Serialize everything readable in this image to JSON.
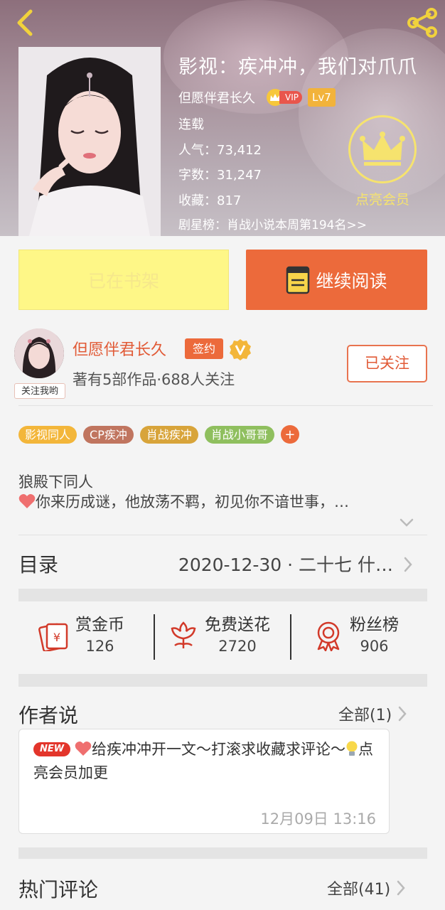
{
  "header": {
    "book_title": "影视：疾冲冲，我们对爪爪",
    "author_name": "但愿伴君长久",
    "vip_label": "VIP",
    "level": "Lv7",
    "status": "连载",
    "popularity": "人气：73,412",
    "word_count": "字数：31,247",
    "favorites": "收藏：817",
    "rank": "剧星榜：肖战小说本周第194名>>",
    "vip_cta": "点亮会员"
  },
  "actions": {
    "shelf_label": "已在书架",
    "read_label": "继续阅读"
  },
  "author": {
    "name": "但愿伴君长久",
    "sign_tag": "签约",
    "follow_me": "关注我哟",
    "stats": "著有5部作品·688人关注",
    "follow_button": "已关注"
  },
  "tags": [
    {
      "label": "影视同人",
      "color": "#f3b63a"
    },
    {
      "label": "CP疾冲",
      "color": "#c0755f"
    },
    {
      "label": "肖战疾冲",
      "color": "#d8a43a"
    },
    {
      "label": "肖战小哥哥",
      "color": "#8fbf5e"
    }
  ],
  "tag_add": "+",
  "synopsis": {
    "line1": "狼殿下同人",
    "line2": "你来历成谜，他放荡不羁，初见你不谙世事，…"
  },
  "catalog": {
    "title": "目录",
    "latest": "2020-12-30 · 二十七 什…"
  },
  "gifts": [
    {
      "label": "赏金币",
      "count": "126",
      "icon": "red-envelope-icon"
    },
    {
      "label": "免费送花",
      "count": "2720",
      "icon": "flower-icon"
    },
    {
      "label": "粉丝榜",
      "count": "906",
      "icon": "medal-icon"
    }
  ],
  "author_says": {
    "title": "作者说",
    "more": "全部(1)",
    "badge": "NEW",
    "text_part1": "给疾冲冲开一文～打滚求收藏求评论～",
    "text_part2": "点亮会员加更",
    "time": "12月09日  13:16"
  },
  "comments": {
    "title": "热门评论",
    "more": "全部(41)"
  },
  "colors": {
    "accent": "#ec6a3b",
    "shelf_yellow": "#fef787",
    "vip_gold": "#f6e36e"
  }
}
